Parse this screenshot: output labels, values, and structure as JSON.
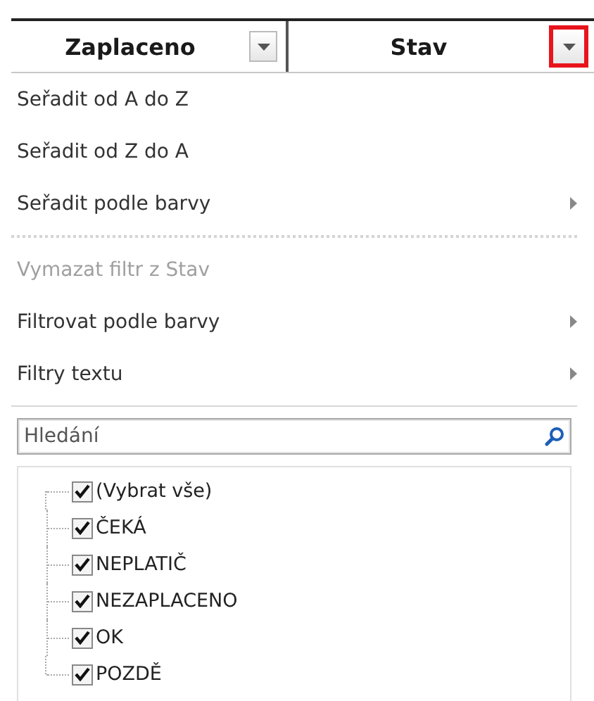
{
  "header": {
    "columns": [
      {
        "label": "Zaplaceno",
        "filter_highlighted": false
      },
      {
        "label": "Stav",
        "filter_highlighted": true
      }
    ]
  },
  "menu": {
    "items": [
      {
        "kind": "item",
        "label": "Seřadit od A do Z",
        "disabled": false,
        "submenu": false
      },
      {
        "kind": "item",
        "label": "Seřadit od Z do A",
        "disabled": false,
        "submenu": false
      },
      {
        "kind": "item",
        "label": "Seřadit podle barvy",
        "disabled": false,
        "submenu": true
      },
      {
        "kind": "dotted-separator"
      },
      {
        "kind": "item",
        "label": "Vymazat filtr z Stav",
        "disabled": true,
        "submenu": false
      },
      {
        "kind": "item",
        "label": "Filtrovat podle barvy",
        "disabled": false,
        "submenu": true
      },
      {
        "kind": "item",
        "label": "Filtry textu",
        "disabled": false,
        "submenu": true
      },
      {
        "kind": "separator"
      }
    ]
  },
  "search": {
    "placeholder": "Hledání"
  },
  "values": [
    {
      "label": "(Vybrat vše)",
      "checked": true
    },
    {
      "label": "ČEKÁ",
      "checked": true
    },
    {
      "label": "NEPLATIČ",
      "checked": true
    },
    {
      "label": "NEZAPLACENO",
      "checked": true
    },
    {
      "label": "OK",
      "checked": true
    },
    {
      "label": "POZDĚ",
      "checked": true
    }
  ]
}
